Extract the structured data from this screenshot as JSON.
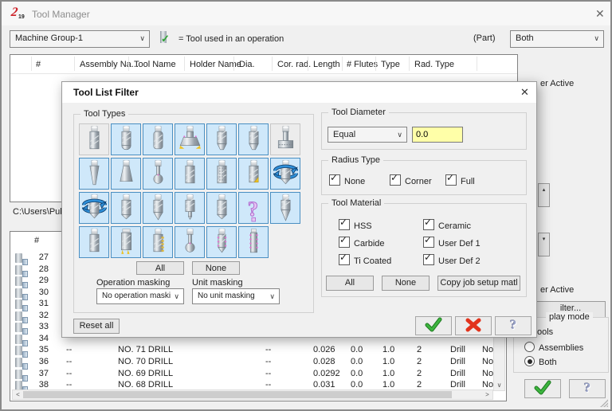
{
  "window": {
    "title": "Tool Manager",
    "close_glyph": "✕"
  },
  "toolbar": {
    "machine_group": "Machine Group-1",
    "tool_used_legend": "= Tool used in an operation",
    "part_label": "(Part)",
    "display_filter_value": "Both"
  },
  "table1": {
    "headers": [
      "#",
      "Assembly Na...",
      "Tool Name",
      "Holder Name",
      "Dia.",
      "Cor. rad.",
      "Length",
      "# Flutes",
      "Type",
      "Rad. Type"
    ]
  },
  "path_text": "C:\\Users\\Public",
  "table2": {
    "header_num": "#",
    "row_icon": "mini-tool-icon",
    "rows": [
      {
        "n": "27"
      },
      {
        "n": "28"
      },
      {
        "n": "29"
      },
      {
        "n": "30"
      },
      {
        "n": "31"
      },
      {
        "n": "32"
      },
      {
        "n": "33"
      },
      {
        "n": "34"
      },
      {
        "n": "35",
        "assembly": "--",
        "name": "NO. 71 DRILL",
        "holder": "--",
        "dia": "0.026",
        "cor": "0.0",
        "len": "1.0",
        "flutes": "2",
        "type": "Drill",
        "rad": "Nor"
      },
      {
        "n": "36",
        "assembly": "--",
        "name": "NO. 70 DRILL",
        "holder": "--",
        "dia": "0.028",
        "cor": "0.0",
        "len": "1.0",
        "flutes": "2",
        "type": "Drill",
        "rad": "Nor"
      },
      {
        "n": "37",
        "assembly": "--",
        "name": "NO. 69 DRILL",
        "holder": "--",
        "dia": "0.0292",
        "cor": "0.0",
        "len": "1.0",
        "flutes": "2",
        "type": "Drill",
        "rad": "Nor"
      },
      {
        "n": "38",
        "assembly": "--",
        "name": "NO. 68 DRILL",
        "holder": "--",
        "dia": "0.031",
        "cor": "0.0",
        "len": "1.0",
        "flutes": "2",
        "type": "Drill",
        "rad": "Nor"
      }
    ]
  },
  "dialog": {
    "title": "Tool List Filter",
    "close_glyph": "✕",
    "tool_types": {
      "label": "Tool Types",
      "cells": [
        {
          "icon": "flat-endmill-icon",
          "selected": false
        },
        {
          "icon": "sphere-endmill-icon",
          "selected": true
        },
        {
          "icon": "bull-endmill-icon",
          "selected": true
        },
        {
          "icon": "face-mill-icon",
          "selected": true
        },
        {
          "icon": "rad-mill-icon",
          "selected": true
        },
        {
          "icon": "chamfer-mill-icon",
          "selected": true
        },
        {
          "icon": "slot-mill-icon",
          "selected": false
        },
        {
          "icon": "taper-mill-icon",
          "selected": true
        },
        {
          "icon": "dove-mill-icon",
          "selected": true
        },
        {
          "icon": "lollipop-mill-icon",
          "selected": true
        },
        {
          "icon": "pencil-mill-icon",
          "selected": true
        },
        {
          "icon": "reamer-icon",
          "selected": true
        },
        {
          "icon": "bore-bar-icon",
          "selected": true
        },
        {
          "icon": "rotary-tool-icon",
          "selected": true
        },
        {
          "icon": "rotary-tool-2-icon",
          "selected": true
        },
        {
          "icon": "spot-drill-icon",
          "selected": true
        },
        {
          "icon": "drill-icon",
          "selected": true
        },
        {
          "icon": "center-drill-icon",
          "selected": true
        },
        {
          "icon": "countersink-icon",
          "selected": true
        },
        {
          "icon": "undefined-tool-icon",
          "selected": true
        },
        {
          "icon": "point-drill-icon",
          "selected": true
        },
        {
          "icon": "endmill-icon",
          "selected": true
        },
        {
          "icon": "shell-mill-icon",
          "selected": true
        },
        {
          "icon": "thread-mill-icon",
          "selected": true
        },
        {
          "icon": "lollipop-2-icon",
          "selected": true
        },
        {
          "icon": "tap-icon",
          "selected": true
        },
        {
          "icon": "thread-tap-icon",
          "selected": true
        }
      ],
      "all_button": "All",
      "none_button": "None",
      "operation_masking_label": "Operation masking",
      "operation_masking_value": "No operation masking",
      "unit_masking_label": "Unit masking",
      "unit_masking_value": "No unit masking"
    },
    "reset_all_button": "Reset all",
    "tool_diameter": {
      "label": "Tool Diameter",
      "operator": "Equal",
      "value": "0.0"
    },
    "radius_type": {
      "label": "Radius Type",
      "options": [
        {
          "label": "None",
          "checked": true
        },
        {
          "label": "Corner",
          "checked": true
        },
        {
          "label": "Full",
          "checked": true
        }
      ]
    },
    "tool_material": {
      "label": "Tool Material",
      "options": [
        {
          "label": "HSS",
          "checked": true
        },
        {
          "label": "Carbide",
          "checked": true
        },
        {
          "label": "Ti Coated",
          "checked": true
        },
        {
          "label": "Ceramic",
          "checked": true
        },
        {
          "label": "User Def 1",
          "checked": true
        },
        {
          "label": "User Def 2",
          "checked": true
        }
      ],
      "all_button": "All",
      "none_button": "None",
      "copy_button": "Copy job setup matl"
    }
  },
  "right_panel": {
    "filter_active_top": "er Active",
    "filter_active_bottom": "er Active",
    "filter_button": "ilter...",
    "display_mode_label": "play mode",
    "tools_label": "ools",
    "radios": [
      {
        "label": "Assemblies",
        "checked": false
      },
      {
        "label": "Both",
        "checked": true
      }
    ]
  },
  "colors": {
    "selected_cell_bg": "#cfe8fa",
    "selected_cell_border": "#4a8fc2",
    "accent_green": "#2fa434",
    "accent_red": "#e2331c",
    "field_yellow": "#ffffa8",
    "logo_red": "#cc2027"
  }
}
